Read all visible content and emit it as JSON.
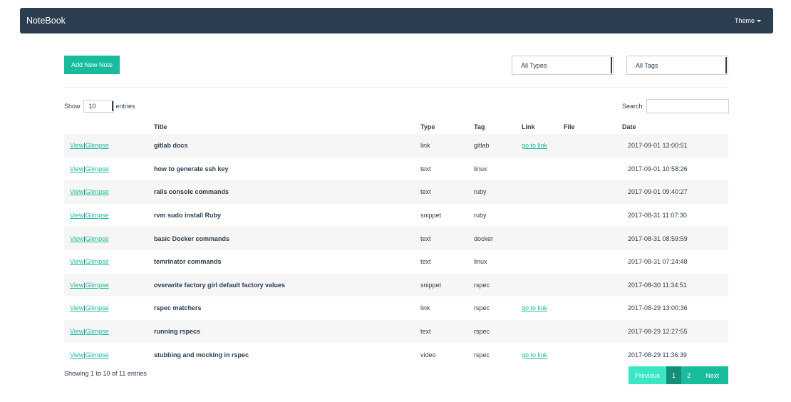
{
  "navbar": {
    "brand": "NoteBook",
    "theme_label": "Theme"
  },
  "toolbar": {
    "add_label": "Add New Note",
    "type_filter": "All Types",
    "tag_filter": "All Tags"
  },
  "table_controls": {
    "show_label": "Show",
    "length_value": "10",
    "entries_label": "entries",
    "search_label": "Search:",
    "search_value": ""
  },
  "columns": {
    "title": "Title",
    "type": "Type",
    "tag": "Tag",
    "link": "Link",
    "file": "File",
    "date": "Date"
  },
  "action_labels": {
    "view": "View",
    "separator": "|",
    "glimpse": "Glimpse"
  },
  "link_label": "go to link",
  "rows": [
    {
      "title": "gitlab docs",
      "type": "link",
      "tag": "gitlab",
      "link": "go to link",
      "file": "",
      "date": "2017-09-01 13:00:51"
    },
    {
      "title": "how to generate ssh key",
      "type": "text",
      "tag": "linux",
      "link": "",
      "file": "",
      "date": "2017-09-01 10:58:26"
    },
    {
      "title": "rails console commands",
      "type": "text",
      "tag": "ruby",
      "link": "",
      "file": "",
      "date": "2017-09-01 09:40:27"
    },
    {
      "title": "rvm sudo install Ruby",
      "type": "snippet",
      "tag": "ruby",
      "link": "",
      "file": "",
      "date": "2017-08-31 11:07:30"
    },
    {
      "title": "basic Docker commands",
      "type": "text",
      "tag": "docker",
      "link": "",
      "file": "",
      "date": "2017-08-31 08:59:59"
    },
    {
      "title": "temrinator commands",
      "type": "text",
      "tag": "linux",
      "link": "",
      "file": "",
      "date": "2017-08-31 07:24:48"
    },
    {
      "title": "overwrite factory girl default factory values",
      "type": "snippet",
      "tag": "rspec",
      "link": "",
      "file": "",
      "date": "2017-08-30 11:34:51"
    },
    {
      "title": "rspec matchers",
      "type": "link",
      "tag": "rspec",
      "link": "go to link",
      "file": "",
      "date": "2017-08-29 13:00:36"
    },
    {
      "title": "running rspecs",
      "type": "text",
      "tag": "rspec",
      "link": "",
      "file": "",
      "date": "2017-08-29 12:27:55"
    },
    {
      "title": "stubbing and mocking in rspec",
      "type": "video",
      "tag": "rspec",
      "link": "go to link",
      "file": "",
      "date": "2017-08-29 11:36:39"
    }
  ],
  "footer": {
    "info": "Showing 1 to 10 of 11 entries",
    "previous": "Previous",
    "pages": [
      "1",
      "2"
    ],
    "current_page": "1",
    "next": "Next"
  },
  "colors": {
    "navbar": "#2c3e50",
    "accent": "#18bc9c",
    "accent_active": "#128f76",
    "accent_disabled": "#3be6c4",
    "row_stripe": "#f6f6f6"
  }
}
